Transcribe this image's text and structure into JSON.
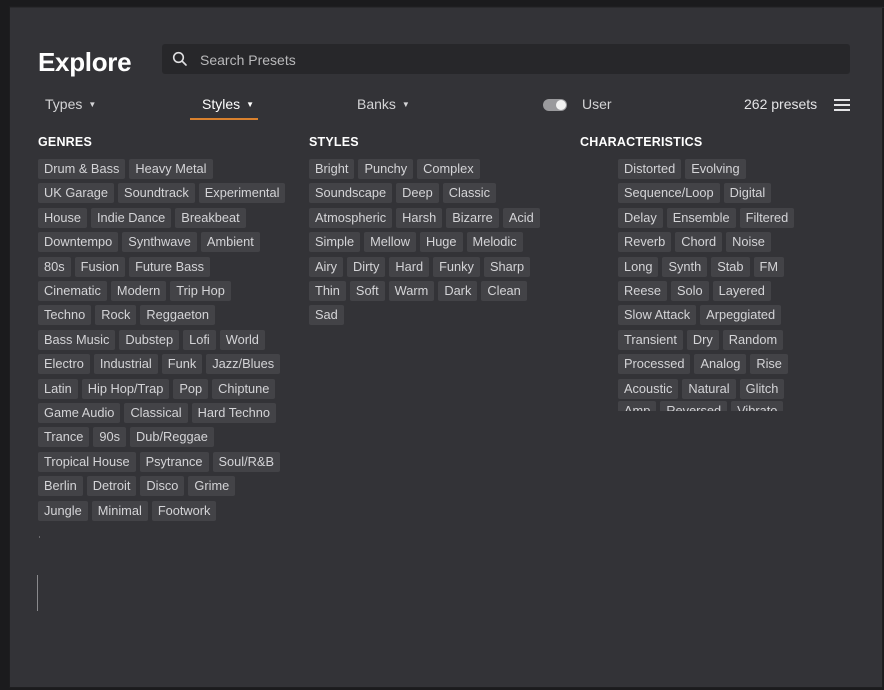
{
  "header": {
    "title": "Explore",
    "search_placeholder": "Search Presets"
  },
  "tabs": [
    {
      "label": "Types",
      "active": false
    },
    {
      "label": "Styles",
      "active": true
    },
    {
      "label": "Banks",
      "active": false
    }
  ],
  "user_toggle": {
    "label": "User",
    "on": false
  },
  "preset_count": "262 presets",
  "colors": {
    "accent": "#d9812e",
    "chip_bg": "#434347",
    "panel_bg": "#333337"
  },
  "columns": {
    "genres": {
      "heading": "GENRES",
      "rows": [
        [
          "Drum & Bass",
          "Heavy Metal"
        ],
        [
          "UK Garage",
          "Soundtrack",
          "Experimental"
        ],
        [
          "House",
          "Indie Dance",
          "Breakbeat"
        ],
        [
          "Downtempo",
          "Synthwave",
          "Ambient"
        ],
        [
          "80s",
          "Fusion",
          "Future Bass"
        ],
        [
          "Cinematic",
          "Modern",
          "Trip Hop"
        ],
        [
          "Techno",
          "Rock",
          "Reggaeton"
        ],
        [
          "Bass Music",
          "Dubstep",
          "Lofi",
          "World"
        ],
        [
          "Electro",
          "Industrial",
          "Funk",
          "Jazz/Blues"
        ],
        [
          "Latin",
          "Hip Hop/Trap",
          "Pop",
          "Chiptune"
        ],
        [
          "Game Audio",
          "Classical",
          "Hard Techno"
        ],
        [
          "Trance",
          "90s",
          "Dub/Reggae"
        ],
        [
          "Tropical House",
          "Psytrance",
          "Soul/R&B"
        ],
        [
          "Berlin",
          "Detroit",
          "Disco",
          "Grime"
        ],
        [
          "Jungle",
          "Minimal",
          "Footwork"
        ]
      ]
    },
    "styles": {
      "heading": "STYLES",
      "rows": [
        [
          "Bright",
          "Punchy",
          "Complex"
        ],
        [
          "Soundscape",
          "Deep",
          "Classic"
        ],
        [
          "Atmospheric",
          "Harsh",
          "Bizarre",
          "Acid"
        ],
        [
          "Simple",
          "Mellow",
          "Huge",
          "Melodic"
        ],
        [
          "Airy",
          "Dirty",
          "Hard",
          "Funky",
          "Sharp"
        ],
        [
          "Thin",
          "Soft",
          "Warm",
          "Dark",
          "Clean"
        ],
        [
          "Sad"
        ]
      ]
    },
    "characteristics": {
      "heading": "CHARACTERISTICS",
      "rows": [
        [
          "Distorted",
          "Evolving"
        ],
        [
          "Sequence/Loop",
          "Digital"
        ],
        [
          "Delay",
          "Ensemble",
          "Filtered"
        ],
        [
          "Reverb",
          "Chord",
          "Noise"
        ],
        [
          "Long",
          "Synth",
          "Stab",
          "FM"
        ],
        [
          "Reese",
          "Solo",
          "Layered"
        ],
        [
          "Slow Attack",
          "Arpeggiated"
        ],
        [
          "Transient",
          "Dry",
          "Random"
        ],
        [
          "Processed",
          "Analog",
          "Rise"
        ],
        [
          "Acoustic",
          "Natural",
          "Glitch"
        ]
      ],
      "partial_row": [
        "Amp",
        "Reversed",
        "Vibrato"
      ]
    }
  }
}
